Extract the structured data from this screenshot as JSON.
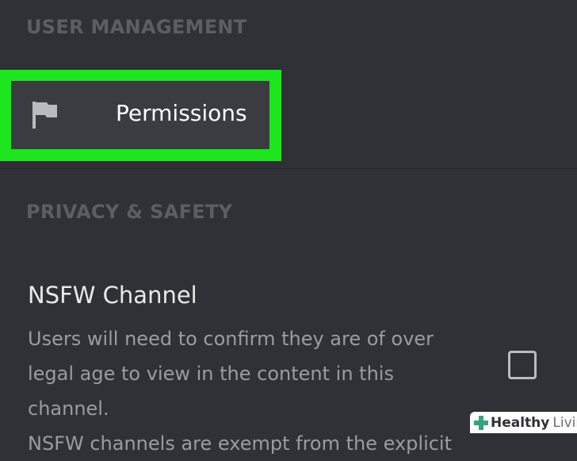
{
  "sections": {
    "user_management": {
      "header": "USER MANAGEMENT",
      "items": [
        {
          "label": "Permissions",
          "icon": "flag-icon"
        }
      ]
    },
    "privacy_safety": {
      "header": "PRIVACY & SAFETY",
      "nsfw": {
        "title": "NSFW Channel",
        "description": "Users will need to confirm they are of over\nlegal age to view in the content in this channel.\nNSFW channels are exempt from the explicit",
        "checked": false
      }
    }
  },
  "watermark": {
    "bold": "Healthy",
    "light": "Living"
  },
  "colors": {
    "background": "#2f3136",
    "highlight": "#1ee61e",
    "row": "#3a3c42",
    "header_text": "#5c5e64"
  }
}
